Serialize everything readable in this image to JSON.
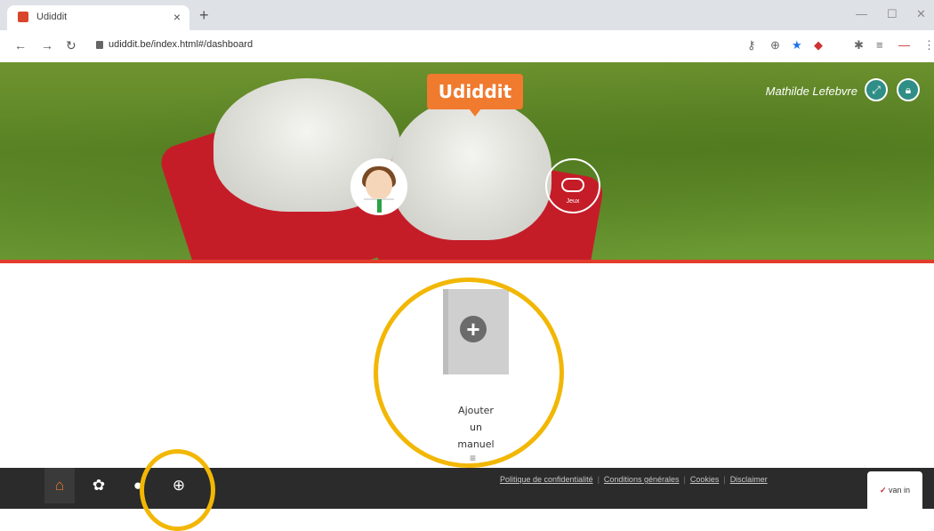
{
  "browser": {
    "tab_title": "Udiddit",
    "url": "udiddit.be/index.html#/dashboard",
    "close_glyph": "×",
    "new_tab_glyph": "+"
  },
  "header": {
    "logo_text": "Udiddit",
    "user_name": "Mathilde Lefebvre",
    "expand_icon": "expand-icon",
    "lock_icon": "lock-icon",
    "game_label": "Jeux"
  },
  "main": {
    "add_manual_word1": "Ajouter",
    "add_manual_word2": "un",
    "add_manual_word3": "manuel",
    "menu_glyph": "≡"
  },
  "footer": {
    "links": [
      "Politique de confidentialité",
      "Conditions générales",
      "Cookies",
      "Disclaimer"
    ],
    "brand": "van in",
    "brand_mark": "✓"
  },
  "colors": {
    "accent_orange": "#f07a2e",
    "hero_border_red": "#e43c2c",
    "teal": "#2f8e86",
    "highlight_ring": "#f2b705",
    "footer_bg": "#2b2b2b"
  }
}
